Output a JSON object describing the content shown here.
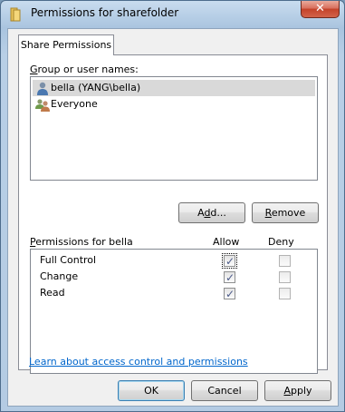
{
  "window": {
    "title": "Permissions for sharefolder",
    "close_glyph": "✕"
  },
  "tabs": [
    {
      "label": "Share Permissions"
    }
  ],
  "groups": {
    "label_prefix": "",
    "label_accel": "G",
    "label_rest": "roup or user names:",
    "items": [
      {
        "label": "bella (YANG\\bella)",
        "icon": "user-icon",
        "selected": true
      },
      {
        "label": "Everyone",
        "icon": "group-icon",
        "selected": false
      }
    ]
  },
  "buttons": {
    "add": {
      "pre": "A",
      "accel": "d",
      "post": "d..."
    },
    "remove": {
      "pre": "",
      "accel": "R",
      "post": "emove"
    },
    "ok": "OK",
    "cancel": "Cancel",
    "apply": {
      "pre": "",
      "accel": "A",
      "post": "pply"
    }
  },
  "permissions": {
    "title_accel": "P",
    "title_rest": "ermissions for bella",
    "allow_header": "Allow",
    "deny_header": "Deny",
    "rows": [
      {
        "name": "Full Control",
        "allow": true,
        "deny": false
      },
      {
        "name": "Change",
        "allow": true,
        "deny": false
      },
      {
        "name": "Read",
        "allow": true,
        "deny": false
      }
    ]
  },
  "help_link": "Learn about access control and permissions",
  "colors": {
    "link": "#0066cc",
    "selection": "#d9d9d9",
    "close": "#c4422a"
  }
}
